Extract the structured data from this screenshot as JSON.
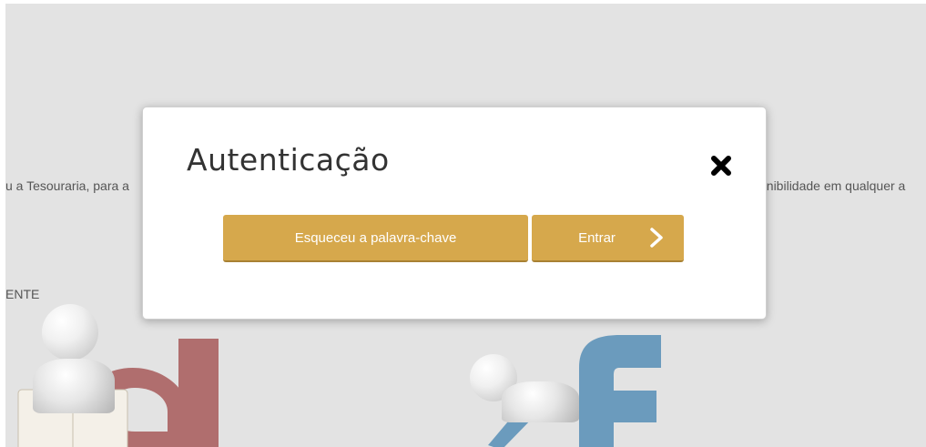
{
  "background": {
    "left_text": "u a Tesouraria, para a",
    "right_text": "onibilidade em qualquer a",
    "label_text": "ENTE"
  },
  "modal": {
    "title": "Autenticação",
    "close_icon": "close-icon",
    "forgot_password_label": "Esqueceu a palavra-chave",
    "enter_label": "Entrar",
    "enter_icon": "chevron-right-icon"
  },
  "colors": {
    "button": "#d6a84c",
    "page_background": "#e3e3e3",
    "letter_d": "#b06e6e",
    "letter_f": "#6b9bbd"
  }
}
